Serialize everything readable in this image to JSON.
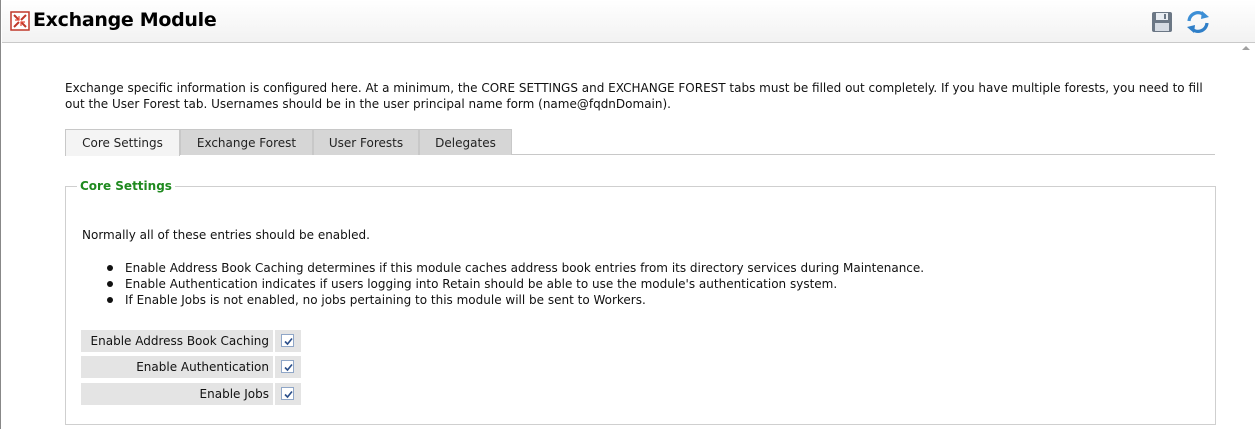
{
  "header": {
    "title": "Exchange Module",
    "module_icon": "module-icon",
    "save_icon": "save-icon",
    "refresh_icon": "refresh-icon"
  },
  "description": "Exchange specific information is configured here. At a minimum, the CORE SETTINGS and EXCHANGE FOREST tabs must be filled out completely. If you have multiple forests, you need to fill out the User Forest tab. Usernames should be in the user principal name form (name@fqdnDomain).",
  "tabs": [
    {
      "label": "Core Settings",
      "active": true
    },
    {
      "label": "Exchange Forest",
      "active": false
    },
    {
      "label": "User Forests",
      "active": false
    },
    {
      "label": "Delegates",
      "active": false
    }
  ],
  "core_settings": {
    "legend": "Core Settings",
    "intro": "Normally all of these entries should be enabled.",
    "bullets": [
      "Enable Address Book Caching determines if this module caches address book entries from its directory services during Maintenance.",
      "Enable Authentication indicates if users logging into Retain should be able to use the module's authentication system.",
      "If Enable Jobs is not enabled, no jobs pertaining to this module will be sent to Workers."
    ],
    "options": [
      {
        "label": "Enable Address Book Caching",
        "checked": true
      },
      {
        "label": "Enable Authentication",
        "checked": true
      },
      {
        "label": "Enable Jobs",
        "checked": true
      }
    ]
  },
  "colors": {
    "legend_green": "#1f8a1f",
    "tab_inactive": "#d6d6d6",
    "tab_active": "#f4f4f4",
    "row_bg": "#e4e4e4"
  }
}
